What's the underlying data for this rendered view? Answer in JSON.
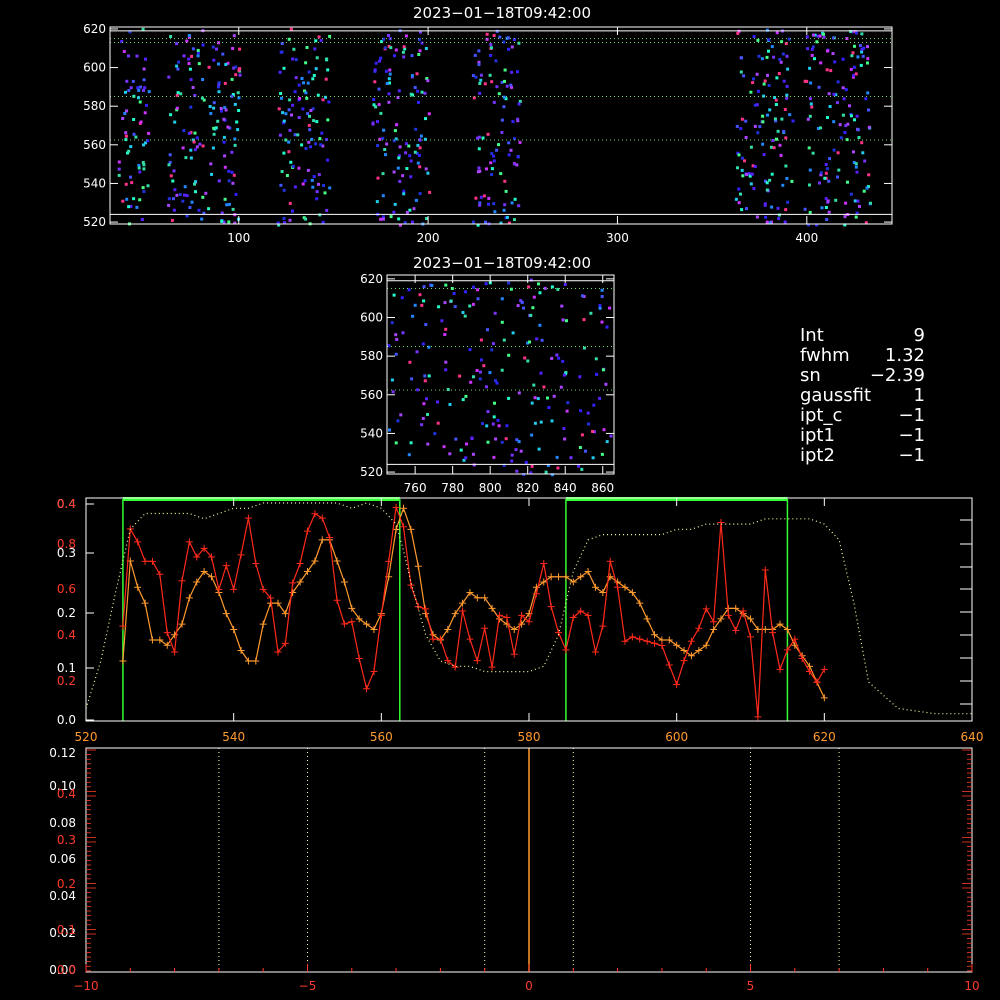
{
  "info": {
    "lines": [
      {
        "key": "Int",
        "value": "9"
      },
      {
        "key": "fwhm",
        "value": "1.32"
      },
      {
        "key": "sn",
        "value": "−2.39"
      },
      {
        "key": "gaussfit",
        "value": "1"
      },
      {
        "key": "ipt_c",
        "value": "−1"
      },
      {
        "key": "ipt1",
        "value": "−1"
      },
      {
        "key": "ipt2",
        "value": "−1"
      }
    ]
  },
  "colors": {
    "white": "#ffffff",
    "orange": "#ff9b2f",
    "red": "#ff2a1a",
    "green": "#33ff33",
    "yellow": "#ffffa0",
    "blue": "#3322ff"
  },
  "chart_data": [
    {
      "type": "heatmap",
      "title": "2023−01−18T09:42:00",
      "xlim": [
        32,
        445
      ],
      "ylim": [
        519,
        621
      ],
      "xticks": [
        100,
        200,
        300,
        400
      ],
      "yticks": [
        520,
        540,
        560,
        580,
        600,
        620
      ],
      "hlines_solid": [
        524,
        619
      ],
      "hlines_dotted": [
        562.5,
        585,
        613,
        615
      ],
      "pixel_clusters": [
        [
          36,
          52
        ],
        [
          62,
          100
        ],
        [
          120,
          148
        ],
        [
          170,
          200
        ],
        [
          223,
          248
        ],
        [
          362,
          392
        ],
        [
          398,
          433
        ]
      ]
    },
    {
      "type": "heatmap",
      "title": "2023−01−18T09:42:00",
      "xlim": [
        745,
        866
      ],
      "ylim": [
        519,
        622
      ],
      "xticks": [
        760,
        780,
        800,
        820,
        840,
        860
      ],
      "yticks": [
        520,
        540,
        560,
        580,
        600,
        620
      ],
      "hlines_solid": [
        524,
        619
      ],
      "hlines_dotted": [
        562.5,
        585,
        615
      ]
    },
    {
      "type": "line",
      "xlim": [
        520,
        640
      ],
      "xticks": [
        520,
        540,
        560,
        580,
        600,
        620,
        640
      ],
      "y_left_white_ticks": [
        "0.0",
        "0.1",
        "0.2",
        "0.3",
        "0.4"
      ],
      "y_left_red_ticks": [
        "0.2",
        "0.4",
        "0.6",
        "0.8"
      ],
      "red_axis_top_label": "0.4",
      "green_boxes": [
        [
          525,
          562.5
        ],
        [
          585,
          615
        ]
      ],
      "series": [
        {
          "color": "orange",
          "x": [
            525,
            526,
            527,
            528,
            529,
            530,
            531,
            532,
            533,
            534,
            535,
            536,
            537,
            538,
            539,
            540,
            541,
            542,
            543,
            544,
            545,
            546,
            547,
            548,
            549,
            550,
            551,
            552,
            553,
            554,
            555,
            556,
            557,
            558,
            559,
            560,
            561,
            562,
            563,
            564,
            565,
            566,
            567,
            568,
            569,
            570,
            571,
            572,
            573,
            574,
            575,
            576,
            577,
            578,
            579,
            580,
            581,
            582,
            583,
            584,
            585,
            586,
            587,
            588,
            589,
            590,
            591,
            592,
            593,
            594,
            595,
            596,
            597,
            598,
            599,
            600,
            601,
            602,
            603,
            604,
            605,
            606,
            607,
            608,
            609,
            610,
            611,
            612,
            613,
            614,
            615,
            616,
            617,
            618,
            619,
            620
          ],
          "y": [
            0.11,
            0.3,
            0.25,
            0.22,
            0.15,
            0.15,
            0.14,
            0.16,
            0.18,
            0.23,
            0.26,
            0.28,
            0.27,
            0.24,
            0.2,
            0.17,
            0.13,
            0.11,
            0.11,
            0.18,
            0.22,
            0.22,
            0.2,
            0.24,
            0.26,
            0.28,
            0.3,
            0.34,
            0.34,
            0.3,
            0.26,
            0.21,
            0.19,
            0.18,
            0.17,
            0.2,
            0.27,
            0.36,
            0.4,
            0.36,
            0.29,
            0.2,
            0.16,
            0.15,
            0.17,
            0.2,
            0.22,
            0.24,
            0.23,
            0.23,
            0.21,
            0.19,
            0.18,
            0.17,
            0.18,
            0.2,
            0.25,
            0.26,
            0.27,
            0.27,
            0.27,
            0.26,
            0.27,
            0.28,
            0.25,
            0.24,
            0.27,
            0.26,
            0.25,
            0.24,
            0.22,
            0.19,
            0.16,
            0.15,
            0.15,
            0.14,
            0.13,
            0.12,
            0.13,
            0.14,
            0.17,
            0.19,
            0.21,
            0.21,
            0.2,
            0.19,
            0.17,
            0.17,
            0.17,
            0.18,
            0.17,
            0.14,
            0.12,
            0.1,
            0.07,
            0.04
          ]
        },
        {
          "color": "red",
          "x": [
            525,
            526,
            527,
            528,
            529,
            530,
            531,
            532,
            533,
            534,
            535,
            536,
            537,
            538,
            539,
            540,
            541,
            542,
            543,
            544,
            545,
            546,
            547,
            548,
            549,
            550,
            551,
            552,
            553,
            554,
            555,
            556,
            557,
            558,
            559,
            560,
            561,
            562,
            563,
            564,
            565,
            566,
            567,
            568,
            569,
            570,
            571,
            572,
            573,
            574,
            575,
            576,
            577,
            578,
            579,
            580,
            581,
            582,
            583,
            584,
            585,
            586,
            587,
            588,
            589,
            590,
            591,
            592,
            593,
            594,
            595,
            596,
            597,
            598,
            599,
            600,
            601,
            602,
            603,
            604,
            605,
            606,
            607,
            608,
            609,
            610,
            611,
            612,
            613,
            614,
            615,
            616,
            617,
            618,
            619,
            620
          ],
          "y": [
            0.43,
            0.88,
            0.82,
            0.73,
            0.73,
            0.67,
            0.4,
            0.31,
            0.64,
            0.82,
            0.75,
            0.79,
            0.75,
            0.6,
            0.71,
            0.6,
            0.76,
            0.93,
            0.72,
            0.6,
            0.56,
            0.31,
            0.35,
            0.63,
            0.72,
            0.87,
            0.95,
            0.93,
            0.84,
            0.55,
            0.44,
            0.45,
            0.28,
            0.14,
            0.22,
            0.48,
            0.73,
            0.98,
            0.89,
            0.62,
            0.52,
            0.51,
            0.37,
            0.37,
            0.27,
            0.24,
            0.5,
            0.37,
            0.27,
            0.42,
            0.24,
            0.48,
            0.47,
            0.3,
            0.48,
            0.45,
            0.58,
            0.72,
            0.52,
            0.4,
            0.32,
            0.47,
            0.5,
            0.48,
            0.31,
            0.43,
            0.73,
            0.61,
            0.36,
            0.38,
            0.37,
            0.36,
            0.35,
            0.34,
            0.25,
            0.16,
            0.27,
            0.36,
            0.42,
            0.51,
            0.45,
            0.91,
            0.48,
            0.41,
            0.5,
            0.38,
            0.01,
            0.69,
            0.4,
            0.23,
            0.32,
            0.37,
            0.28,
            0.22,
            0.17,
            0.23
          ]
        },
        {
          "color": "yellow_dotted",
          "x": [
            520,
            522,
            524,
            526,
            528,
            530,
            532,
            534,
            536,
            538,
            540,
            542,
            544,
            546,
            548,
            550,
            552,
            554,
            556,
            558,
            560,
            562,
            563,
            564,
            566,
            568,
            570,
            572,
            574,
            576,
            578,
            580,
            582,
            584,
            586,
            588,
            590,
            592,
            594,
            596,
            598,
            600,
            602,
            604,
            606,
            608,
            610,
            612,
            614,
            616,
            618,
            620,
            622,
            624,
            626,
            630,
            635,
            640
          ],
          "y": [
            0.02,
            0.11,
            0.24,
            0.36,
            0.39,
            0.39,
            0.39,
            0.39,
            0.38,
            0.39,
            0.4,
            0.4,
            0.41,
            0.41,
            0.41,
            0.41,
            0.41,
            0.41,
            0.4,
            0.41,
            0.4,
            0.37,
            0.32,
            0.26,
            0.16,
            0.11,
            0.1,
            0.1,
            0.09,
            0.09,
            0.09,
            0.09,
            0.1,
            0.16,
            0.28,
            0.34,
            0.35,
            0.35,
            0.35,
            0.35,
            0.35,
            0.36,
            0.36,
            0.37,
            0.37,
            0.37,
            0.37,
            0.38,
            0.38,
            0.38,
            0.38,
            0.37,
            0.34,
            0.22,
            0.07,
            0.02,
            0.01,
            0.01
          ]
        }
      ]
    },
    {
      "type": "line",
      "xlim": [
        -10,
        10
      ],
      "xticks": [
        "−10",
        "−5",
        "0",
        "5",
        "10"
      ],
      "y_left_white_ticks": [
        "0.00",
        "0.02",
        "0.04",
        "0.06",
        "0.08",
        "0.10",
        "0.12"
      ],
      "y_left_red_ticks": [
        "0.0",
        "0.1",
        "0.2",
        "0.3",
        "0.4"
      ],
      "vlines_dotted_yellow": [
        -7,
        -5,
        -1,
        1,
        5,
        7
      ],
      "vline_orange": 0
    }
  ]
}
